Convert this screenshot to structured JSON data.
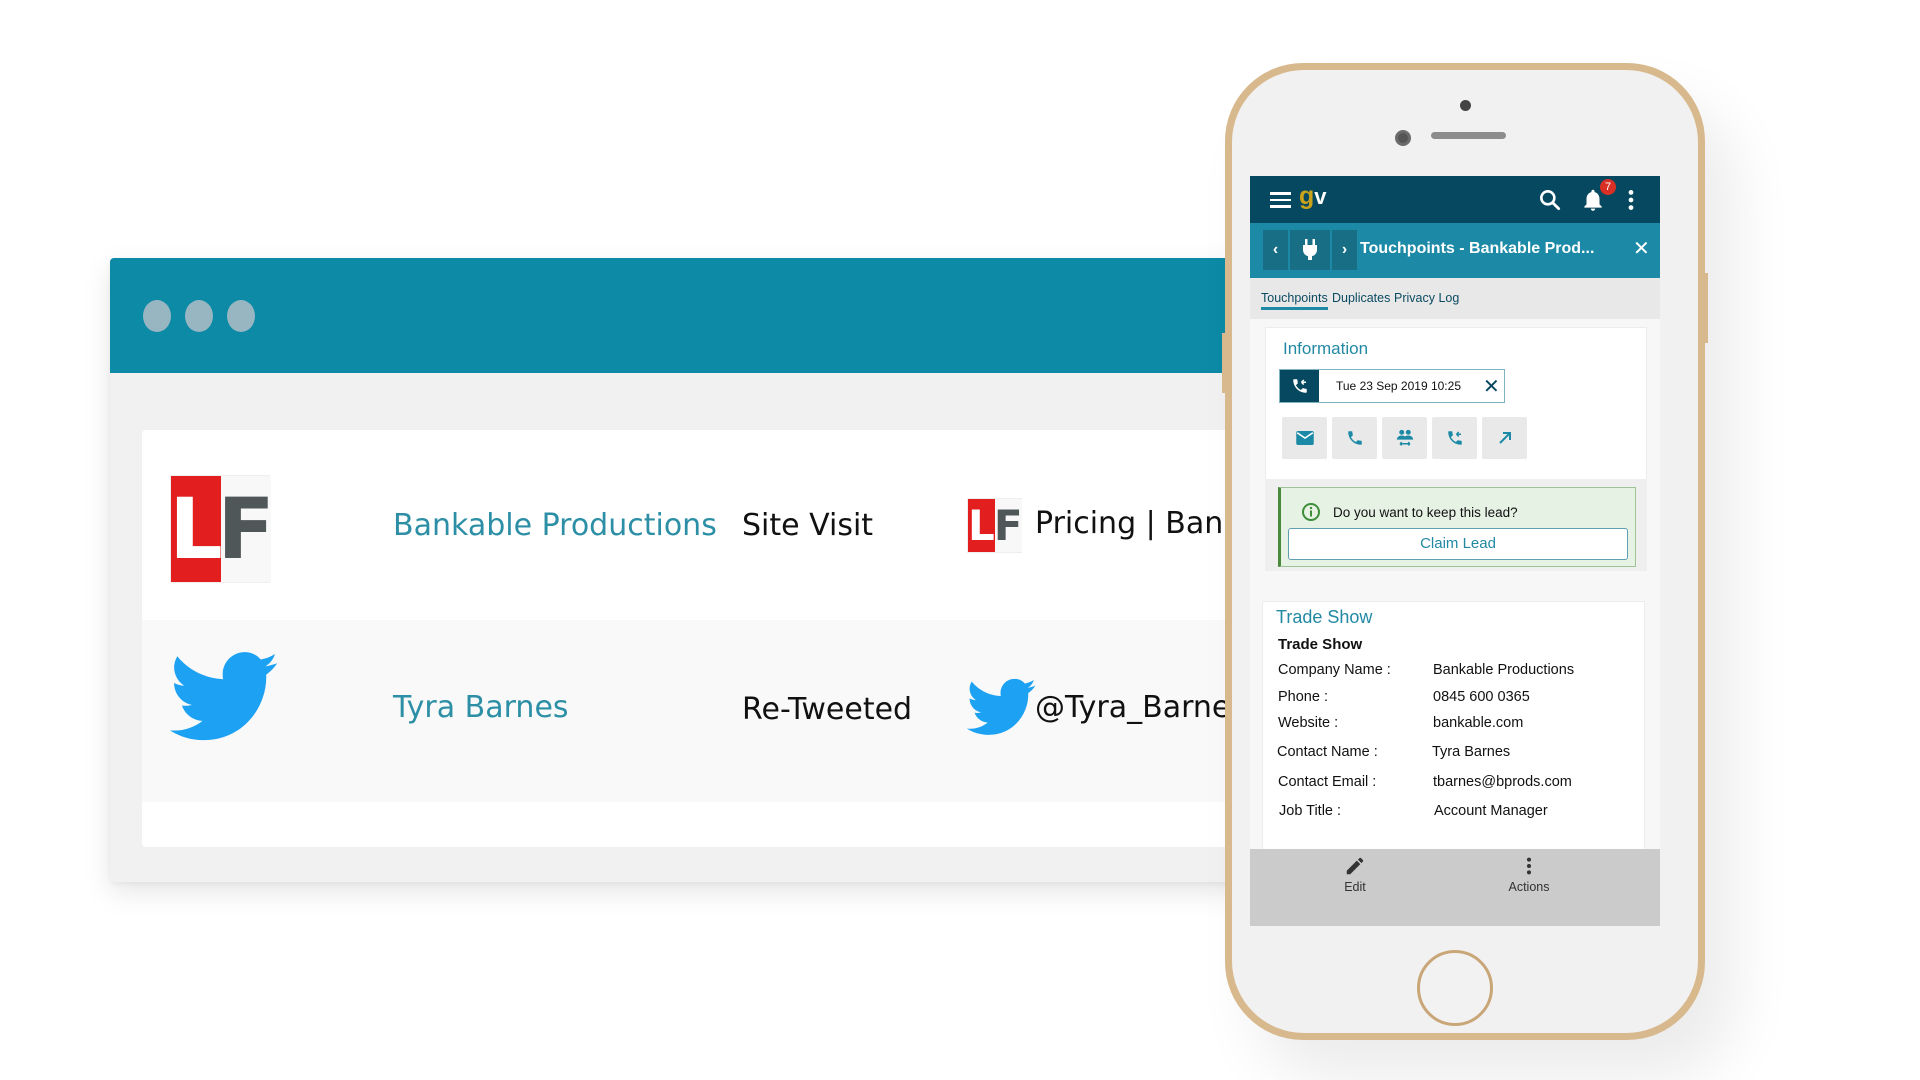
{
  "browser": {
    "window_dots": 3,
    "rows": [
      {
        "logo": "lf-logo",
        "logo_letters": [
          "L",
          "F"
        ],
        "name": "Bankable Productions",
        "type": "Site Visit",
        "detail_icon": "lf-logo",
        "detail": "Pricing | Ban"
      },
      {
        "logo": "twitter-bird-icon",
        "name": "Tyra Barnes",
        "type": "Re-Tweeted",
        "detail_icon": "twitter-bird-icon",
        "detail": "@Tyra_Barne"
      }
    ]
  },
  "phone": {
    "appbar": {
      "logo_g": "g",
      "logo_v": "v",
      "notification_count": "7",
      "icons": [
        "menu-icon",
        "search-icon",
        "bell-icon",
        "more-vert-icon"
      ]
    },
    "subheader": {
      "title": "Touchpoints - Bankable Prod...",
      "icons": [
        "chevron-left-icon",
        "plug-icon",
        "chevron-right-icon",
        "close-icon"
      ]
    },
    "tabs": [
      {
        "label": "Touchpoints",
        "active": true
      },
      {
        "label": "Duplicates",
        "active": false
      },
      {
        "label": "Privacy Log",
        "active": false
      }
    ],
    "information": {
      "title": "Information",
      "date": "Tue 23 Sep 2019 10:25",
      "action_icons": [
        "email-icon",
        "phone-icon",
        "meeting-icon",
        "callback-icon",
        "outbound-arrow-icon"
      ]
    },
    "alert": {
      "message": "Do you want to keep this lead?",
      "button": "Claim Lead"
    },
    "trade_show": {
      "title": "Trade Show",
      "subtitle": "Trade Show",
      "fields": [
        {
          "label": "Company Name :",
          "value": "Bankable Productions"
        },
        {
          "label": "Phone :",
          "value": "0845 600 0365"
        },
        {
          "label": "Website :",
          "value": "bankable.com"
        },
        {
          "label": "Contact Name :",
          "value": "Tyra Barnes"
        },
        {
          "label": "Contact Email :",
          "value": "tbarnes@bprods.com"
        },
        {
          "label": "Job Title :",
          "value": "Account Manager"
        }
      ]
    },
    "bottom_bar": {
      "edit": "Edit",
      "actions": "Actions"
    }
  },
  "colors": {
    "browser_header": "#0c8aa6",
    "app_bar": "#05485f",
    "sub_header": "#1c8aa6",
    "accent_text": "#2289a3",
    "twitter_blue": "#1da1f2",
    "lf_red": "#e21e1e",
    "badge_red": "#d93025",
    "alert_green": "#4a8a3c",
    "phone_gold": "#d8b98d"
  }
}
